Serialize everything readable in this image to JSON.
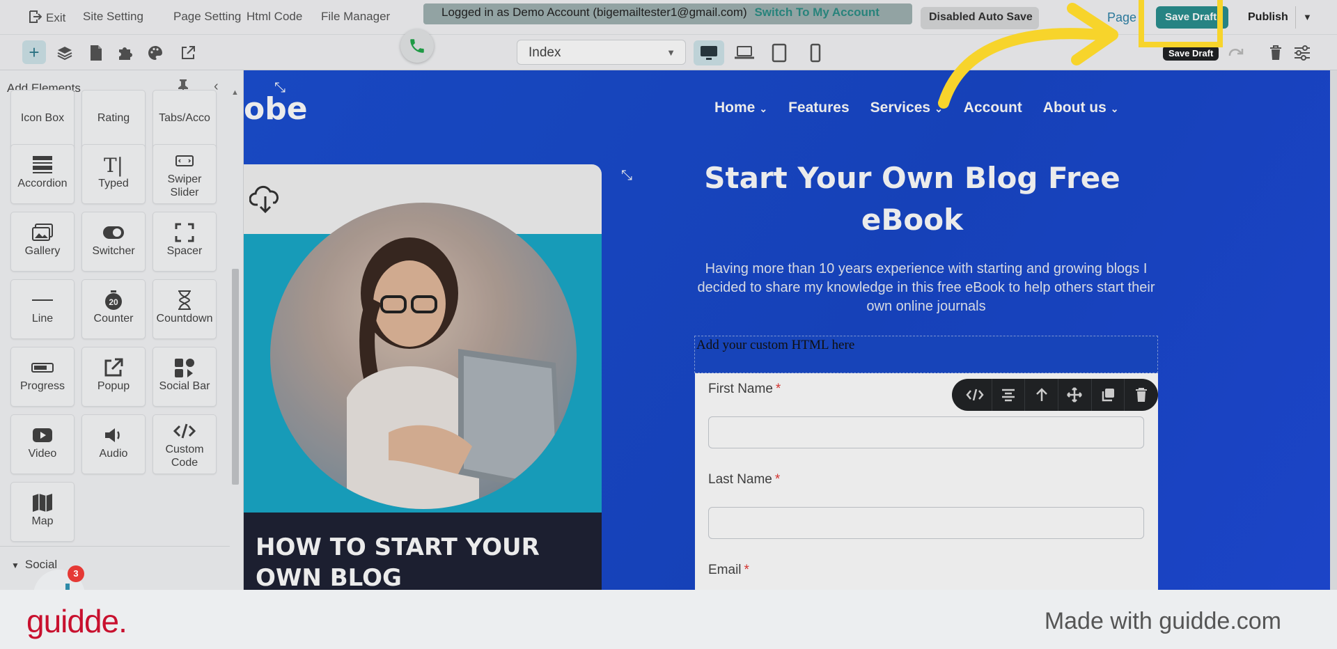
{
  "topbar": {
    "exit": "Exit",
    "site_setting": "Site Setting",
    "page_setting": "Page Setting",
    "html_code": "Html Code",
    "file_manager": "File Manager",
    "login_text": "Logged in as Demo Account (bigemailtester1@gmail.com)",
    "switch_account": "Switch To My Account",
    "autosave": "Disabled Auto Save",
    "page_link": "Page",
    "save_draft": "Save Draft",
    "publish": "Publish",
    "tooltip": "Save Draft"
  },
  "toolbar2": {
    "page_select_value": "Index"
  },
  "sidebar": {
    "title": "Add Elements",
    "elements": [
      {
        "label": "Icon Box",
        "icon": "icon-box-icon"
      },
      {
        "label": "Rating",
        "icon": "star-icon"
      },
      {
        "label": "Tabs/Acco",
        "icon": "tabs-icon"
      },
      {
        "label": "Accordion",
        "icon": "accordion-icon"
      },
      {
        "label": "Typed",
        "icon": "typed-icon"
      },
      {
        "label": "Swiper Slider",
        "icon": "slider-icon"
      },
      {
        "label": "Gallery",
        "icon": "gallery-icon"
      },
      {
        "label": "Switcher",
        "icon": "toggle-icon"
      },
      {
        "label": "Spacer",
        "icon": "spacer-icon"
      },
      {
        "label": "Line",
        "icon": "line-icon"
      },
      {
        "label": "Counter",
        "icon": "counter-icon"
      },
      {
        "label": "Countdown",
        "icon": "hourglass-icon"
      },
      {
        "label": "Progress",
        "icon": "progress-icon"
      },
      {
        "label": "Popup",
        "icon": "popup-icon"
      },
      {
        "label": "Social Bar",
        "icon": "social-bar-icon"
      },
      {
        "label": "Video",
        "icon": "video-icon"
      },
      {
        "label": "Audio",
        "icon": "audio-icon"
      },
      {
        "label": "Custom Code",
        "icon": "code-icon"
      },
      {
        "label": "Map",
        "icon": "map-icon"
      }
    ],
    "social_section": "Social",
    "chat_badge": "3"
  },
  "canvas": {
    "logo_fragment": "obe",
    "nav": [
      "Home",
      "Features",
      "Services",
      "Account",
      "About us"
    ],
    "hero_title": "Start Your Own Blog Free eBook",
    "hero_desc": "Having more than 10 years experience with starting and growing blogs I decided to share my knowledge in this free eBook to help others start their own online journals",
    "custom_html": "Add your custom HTML here",
    "ebook_title": "HOW TO START YOUR OWN BLOG",
    "form": {
      "first_name": "First Name",
      "last_name": "Last Name",
      "email": "Email",
      "required_mark": "*"
    }
  },
  "footer": {
    "logo": "guidde.",
    "made_with": "Made with guidde.com"
  },
  "colors": {
    "accent": "#2a8f8f",
    "highlight": "#f7d42b",
    "canvas_blue": "#1b4fd2",
    "guidde_red": "#c8102e"
  }
}
